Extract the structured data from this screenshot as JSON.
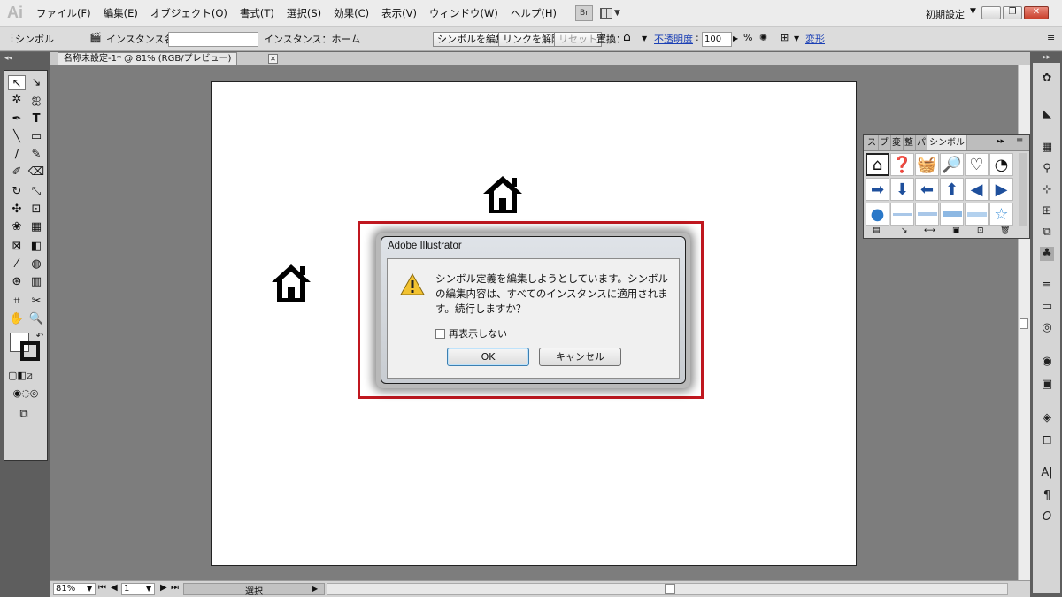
{
  "app": {
    "logo": "Ai"
  },
  "menubar": {
    "items": [
      "ファイル(F)",
      "編集(E)",
      "オブジェクト(O)",
      "書式(T)",
      "選択(S)",
      "効果(C)",
      "表示(V)",
      "ウィンドウ(W)",
      "ヘルプ(H)"
    ],
    "bridge_label": "Br",
    "workspace": "初期設定"
  },
  "window_controls": {
    "minimize": "─",
    "restore": "❐",
    "close": "✕"
  },
  "controlbar": {
    "selection_type": "シンボル",
    "instance_name_label": "インスタンス名：",
    "instance_name_value": "",
    "instance_of": "インスタンス：ホーム",
    "edit_symbol": "シンボルを編集",
    "break_link": "リンクを解除",
    "reset": "リセット",
    "replace_label": "置換：",
    "opacity_label": "不透明度",
    "opacity_value": "100",
    "opacity_unit": "%",
    "transform_label": "変形"
  },
  "document": {
    "tab_title": "名称未設定-1* @ 81% (RGB/プレビュー)",
    "zoom": "81%",
    "artboard": "1",
    "status": "選択"
  },
  "symbols_panel": {
    "tabs": [
      "ス",
      "ブ",
      "変",
      "整",
      "パ",
      "シンボル"
    ],
    "active_tab": "シンボル",
    "symbols": [
      "house-icon",
      "question-icon",
      "basket-icon",
      "magnifier-icon",
      "heart-icon",
      "rss-icon",
      "arrow-right-icon",
      "arrow-down-icon",
      "arrow-left-icon",
      "arrow-up-icon",
      "triangle-left-icon",
      "triangle-right-icon",
      "globe-icon",
      "bar-thin-icon",
      "bar-medium-icon",
      "bar-thick-icon",
      "bar-gel-icon",
      "star-icon"
    ]
  },
  "dialog": {
    "title": "Adobe Illustrator",
    "message": "シンボル定義を編集しようとしています。シンボルの編集内容は、すべてのインスタンスに適用されます。続行しますか？",
    "dont_show_again": "再表示しない",
    "ok": "OK",
    "cancel": "キャンセル"
  },
  "colors": {
    "highlight": "#c0171f",
    "ok_border": "#3c7fb1",
    "link": "#1a3fb5"
  }
}
